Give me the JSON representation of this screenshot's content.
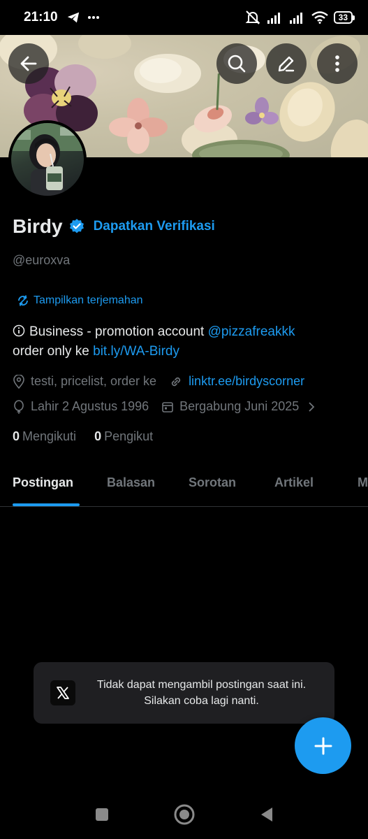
{
  "status_bar": {
    "time": "21:10",
    "battery": "33",
    "icons": [
      "telegram-icon",
      "more-dots-icon",
      "mute-icon",
      "signal-icon",
      "signal-icon",
      "wifi-icon",
      "battery-icon"
    ]
  },
  "header": {
    "back_icon": "arrow-left-icon",
    "search_icon": "search-icon",
    "edit_icon": "pencil-icon",
    "more_icon": "vertical-dots-icon"
  },
  "profile": {
    "name": "Birdy",
    "verify_link": "Dapatkan Verifikasi",
    "handle": "@euroxva",
    "translate": "Tampilkan terjemahan",
    "bio_prefix": "Business - promotion account ",
    "bio_mention": "@pizzafreakkk",
    "bio_middle": "order only ke ",
    "bio_link": "bit.ly/WA-Birdy",
    "location": "testi, pricelist, order ke",
    "website": "linktr.ee/birdyscorner",
    "birthday": "Lahir 2 Agustus 1996",
    "joined": "Bergabung Juni 2025",
    "following_count": "0",
    "following_label": "Mengikuti",
    "followers_count": "0",
    "followers_label": "Pengikut"
  },
  "tabs": [
    {
      "label": "Postingan",
      "active": true
    },
    {
      "label": "Balasan",
      "active": false
    },
    {
      "label": "Sorotan",
      "active": false
    },
    {
      "label": "Artikel",
      "active": false
    },
    {
      "label": "M",
      "active": false
    }
  ],
  "toast": {
    "message": "Tidak dapat mengambil postingan saat ini. Silakan coba lagi nanti.",
    "logo": "x-logo-icon"
  },
  "fab": {
    "icon": "plus-icon"
  },
  "navbar": {
    "icons": [
      "recent-apps-icon",
      "home-icon",
      "back-triangle-icon"
    ]
  },
  "colors": {
    "accent": "#1d9bf0",
    "background": "#000000",
    "text_primary": "#e7e9ea",
    "text_secondary": "#71767b"
  }
}
